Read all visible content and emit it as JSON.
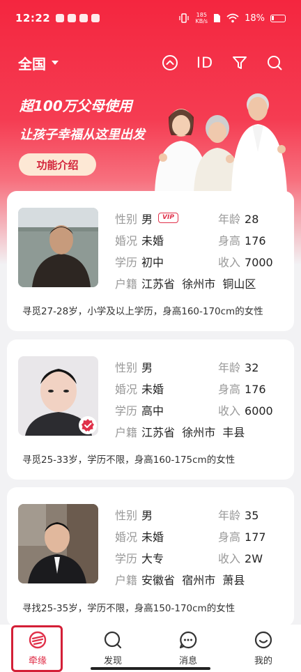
{
  "status_bar": {
    "time": "12:22",
    "net_speed_value": "185",
    "net_speed_unit": "KB/s",
    "battery": "18%"
  },
  "topnav": {
    "region": "全国",
    "id_label": "ID"
  },
  "banner": {
    "line1": "超100万父母使用",
    "line2": "让孩子幸福从这里出发",
    "button": "功能介绍"
  },
  "labels": {
    "gender": "性别",
    "marital": "婚况",
    "education": "学历",
    "hukou": "户籍",
    "age": "年龄",
    "height": "身高",
    "income": "收入",
    "vip": "VIP"
  },
  "profiles": [
    {
      "gender": "男",
      "age": "28",
      "marital": "未婚",
      "height": "176",
      "education": "初中",
      "income": "7000",
      "hukou": "江苏省  徐州市  铜山区",
      "seeking": "寻觅27-28岁，小学及以上学历，身高160-170cm的女性"
    },
    {
      "gender": "男",
      "age": "32",
      "marital": "未婚",
      "height": "176",
      "education": "高中",
      "income": "6000",
      "hukou": "江苏省  徐州市  丰县",
      "seeking": "寻觅25-33岁，学历不限，身高160-175cm的女性"
    },
    {
      "gender": "男",
      "age": "35",
      "marital": "未婚",
      "height": "177",
      "education": "大专",
      "income": "2W",
      "hukou": "安徽省  宿州市  萧县",
      "seeking": "寻找25-35岁，学历不限，身高150-170cm的女性"
    }
  ],
  "bottom_nav": [
    {
      "label": "牵缘",
      "icon": "qianyuan-logo-icon",
      "active": true
    },
    {
      "label": "发现",
      "icon": "discover-icon",
      "active": false
    },
    {
      "label": "消息",
      "icon": "message-icon",
      "active": false
    },
    {
      "label": "我的",
      "icon": "profile-smile-icon",
      "active": false
    }
  ],
  "colors": {
    "brand_red": "#f4263f",
    "accent": "#e0314a",
    "button_bg": "#fde8d5"
  }
}
